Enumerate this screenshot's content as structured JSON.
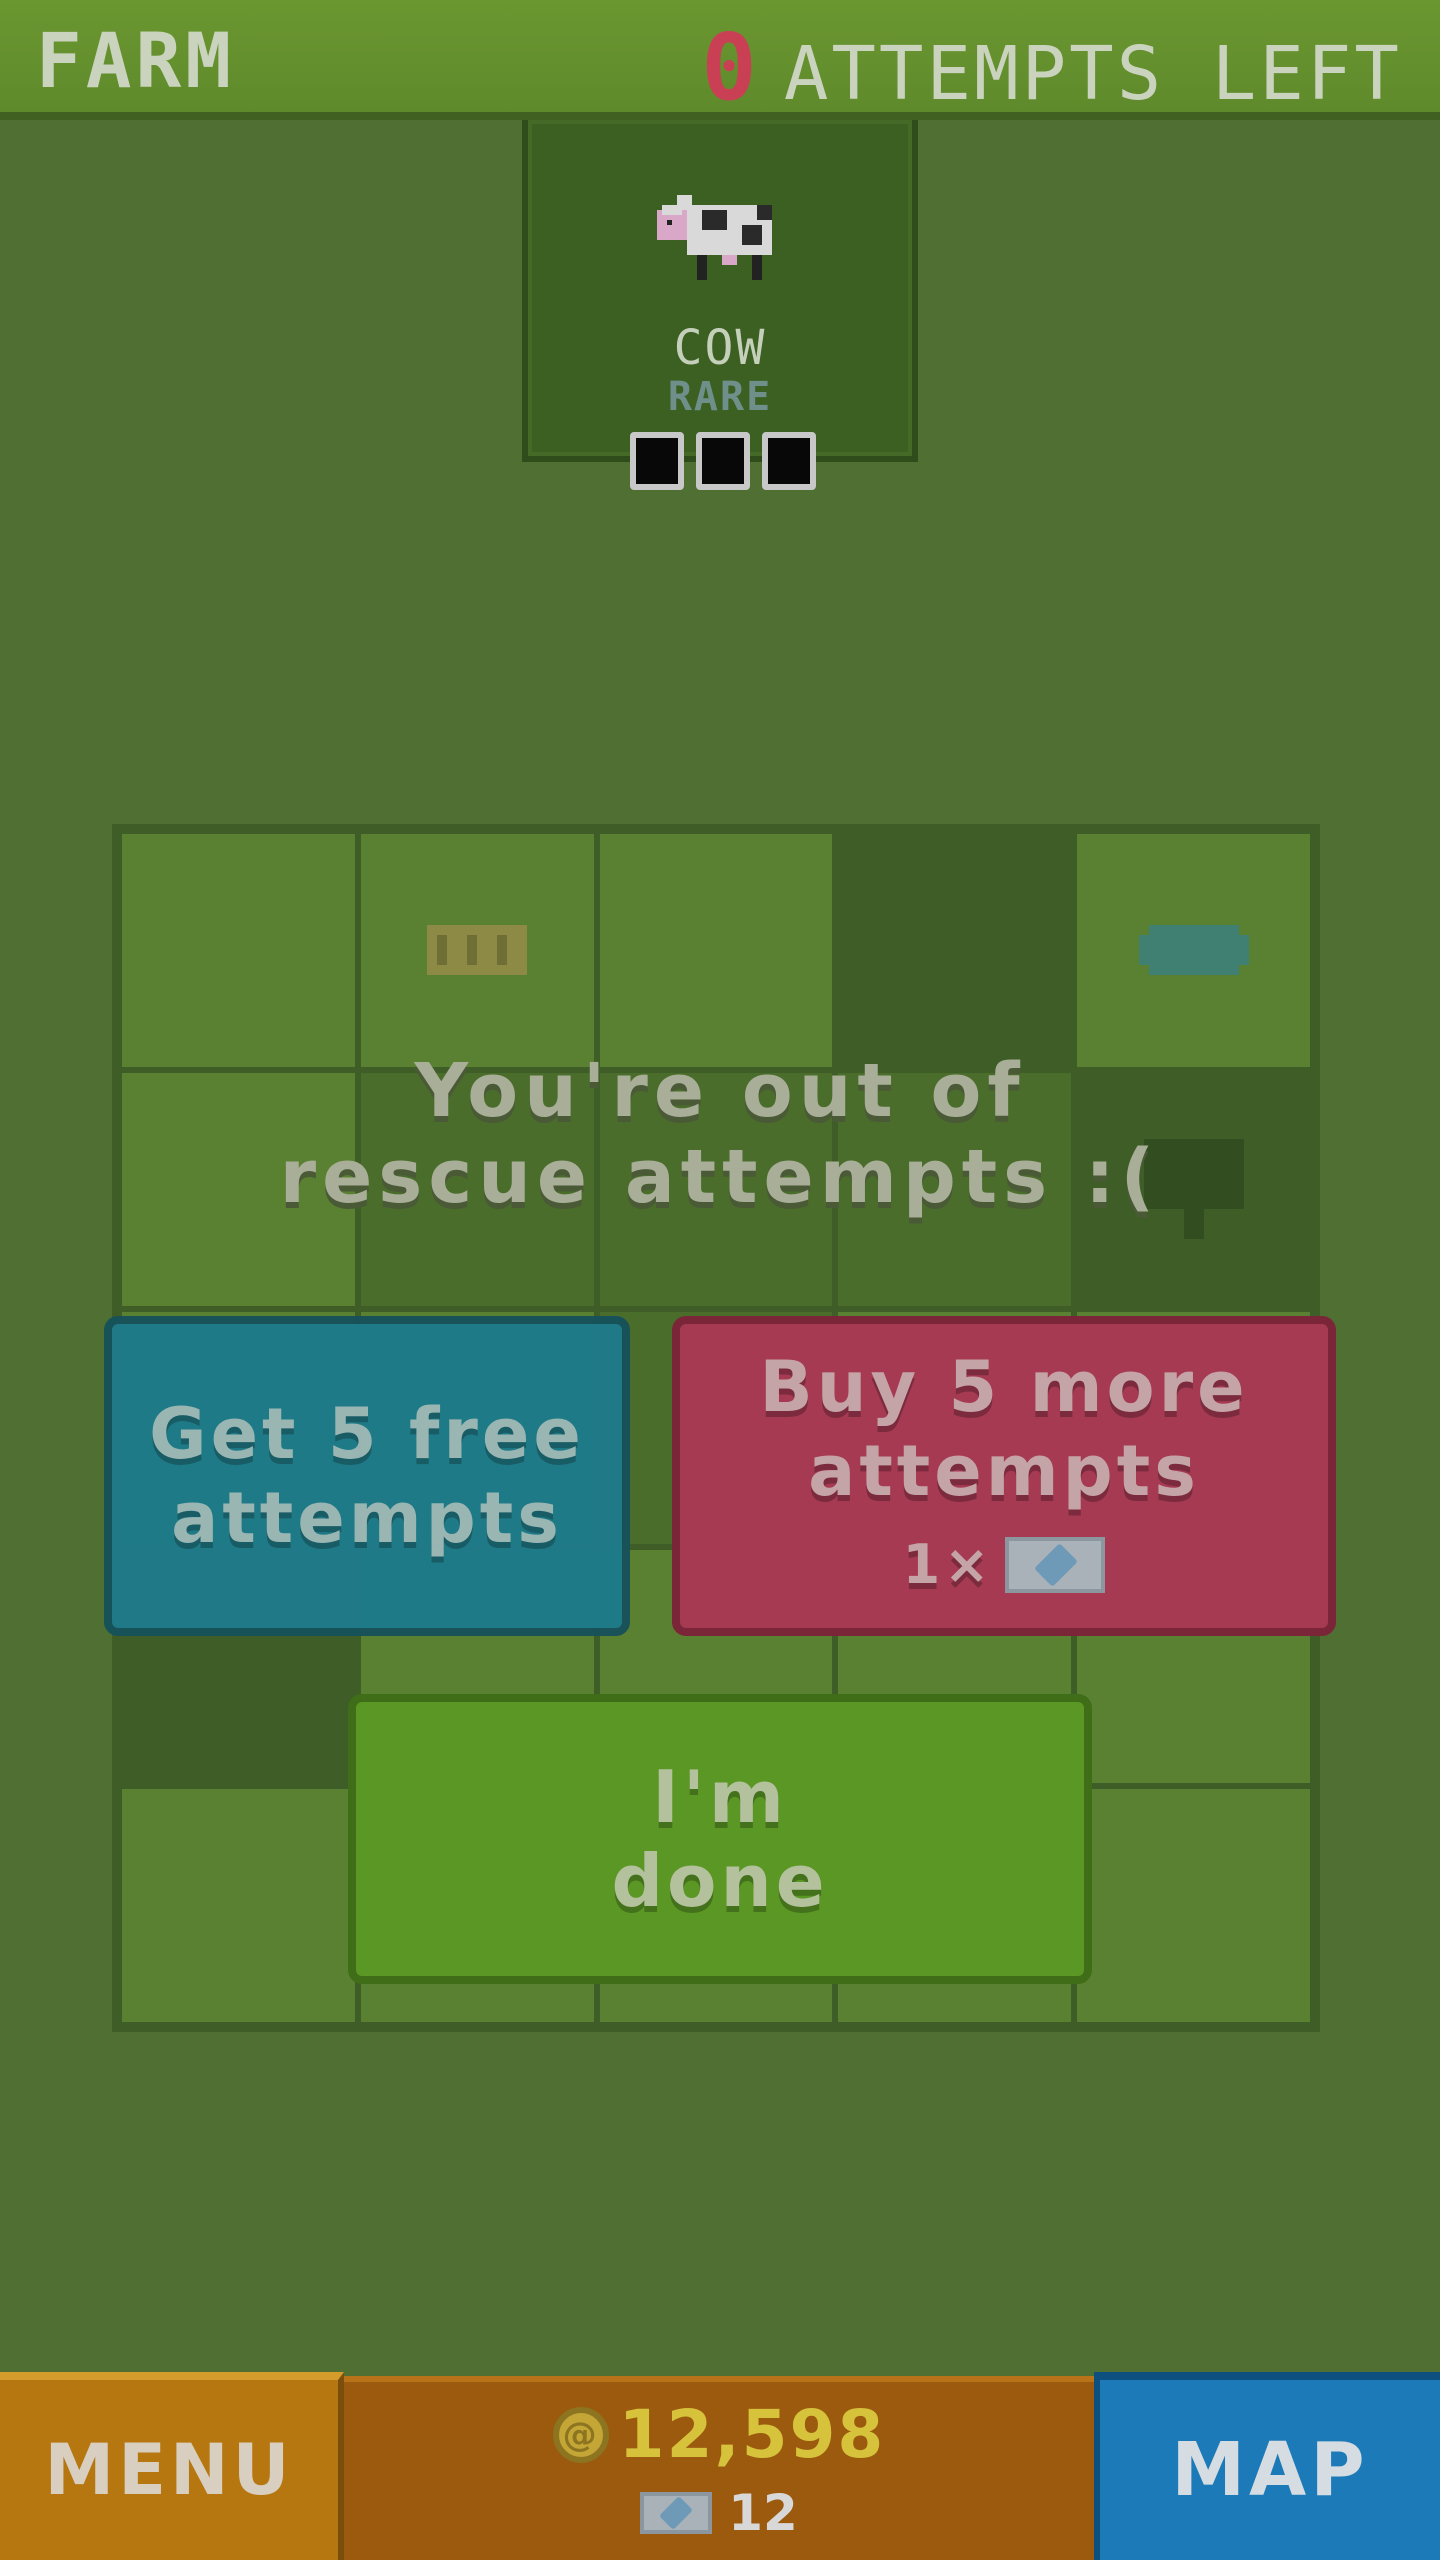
{
  "header": {
    "area_name": "FARM",
    "attempts_left_count": "0",
    "attempts_left_label": "ATTEMPTS LEFT"
  },
  "target": {
    "animal_name": "COW",
    "rarity": "RARE",
    "icon": "cow-sprite",
    "progress_filled": 0,
    "progress_total": 3
  },
  "dialog": {
    "message_line1": "You're out of",
    "message_line2": "rescue attempts :("
  },
  "buttons": {
    "free_line1": "Get 5 free",
    "free_line2": "attempts",
    "buy_line1": "Buy 5 more",
    "buy_line2": "attempts",
    "buy_cost": "1×",
    "done_line1": "I'm",
    "done_line2": "done"
  },
  "bottom": {
    "menu_label": "MENU",
    "coins": "12,598",
    "gems": "12",
    "map_label": "MAP"
  },
  "colors": {
    "background": "#4f6f33",
    "free_button": "#1e7a8a",
    "buy_button": "#a53a52",
    "done_button": "#5b9724",
    "menu_button": "#b67710",
    "map_button": "#1d7ab8",
    "attempts_count": "#c94055"
  }
}
